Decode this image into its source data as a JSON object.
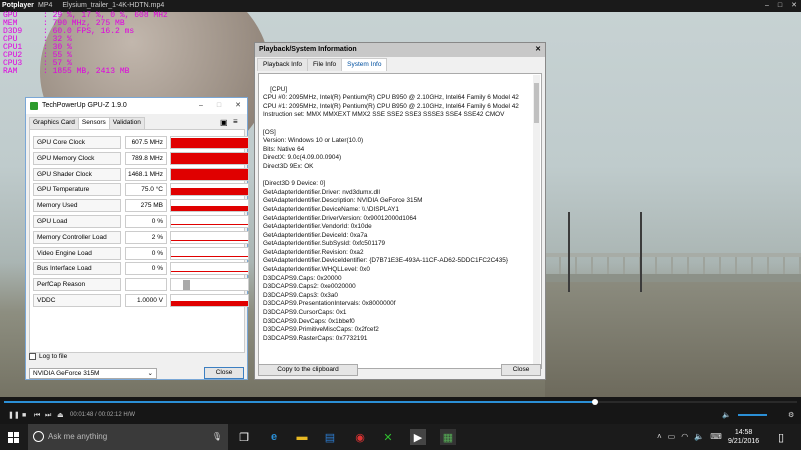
{
  "player": {
    "app_name": "Potplayer",
    "format_tab": "MP4",
    "file_name": "Elysium_trailer_1-4K-HDTN.mp4",
    "window_buttons": [
      "–",
      "□",
      "✕"
    ]
  },
  "osd": [
    {
      "k": "GPU",
      "v": ": 29 %, 17 %, 0 %, 608 MHz"
    },
    {
      "k": "MEM",
      "v": ": 790 MHz, 275 MB"
    },
    {
      "k": "D3D9",
      "v": ": 60.0 FPS, 16.2 ms"
    },
    {
      "k": "CPU",
      "v": ": 32 %"
    },
    {
      "k": "CPU1",
      "v": ": 30 %"
    },
    {
      "k": "CPU2",
      "v": ": 55 %"
    },
    {
      "k": "CPU3",
      "v": ": 57 %"
    },
    {
      "k": "RAM",
      "v": ": 1855 MB, 2413 MB"
    }
  ],
  "controls": {
    "time": "00:01:48 / 00:02:12  H/W",
    "seek_progress": 0.745,
    "volume": 0.8
  },
  "taskbar": {
    "search_placeholder": "Ask me anything",
    "time": "14:58",
    "date": "9/21/2016"
  },
  "gpuz": {
    "title": "TechPowerUp GPU-Z 1.9.0",
    "tabs": [
      "Graphics Card",
      "Sensors",
      "Validation"
    ],
    "active_tab": "Sensors",
    "sensors": [
      {
        "label": "GPU Core Clock",
        "value": "607.5 MHz",
        "level": 0.95
      },
      {
        "label": "GPU Memory Clock",
        "value": "789.8 MHz",
        "level": 0.95
      },
      {
        "label": "GPU Shader Clock",
        "value": "1468.1 MHz",
        "level": 0.95
      },
      {
        "label": "GPU Temperature",
        "value": "75.0 °C",
        "level": 0.7
      },
      {
        "label": "Memory Used",
        "value": "275 MB",
        "level": 0.45
      },
      {
        "label": "GPU Load",
        "value": "0 %",
        "level": 0
      },
      {
        "label": "Memory Controller Load",
        "value": "2 %",
        "level": 0
      },
      {
        "label": "Video Engine Load",
        "value": "0 %",
        "level": 0
      },
      {
        "label": "Bus Interface Load",
        "value": "0 %",
        "level": 0
      },
      {
        "label": "PerfCap Reason",
        "value": "",
        "level": 0
      },
      {
        "label": "VDDC",
        "value": "1.0000 V",
        "level": 0.45
      }
    ],
    "log_to_file": "Log to file",
    "gpu_select": "NVIDIA GeForce 315M",
    "close": "Close"
  },
  "pbinfo": {
    "title": "Playback/System Information",
    "tabs": [
      "Playback Info",
      "File Info",
      "System Info"
    ],
    "active_tab": "System Info",
    "text": "[CPU]\nCPU #0: 2095MHz, Intel(R) Pentium(R) CPU B950 @ 2.10GHz, Intel64 Family 6 Model 42\nCPU #1: 2095MHz, Intel(R) Pentium(R) CPU B950 @ 2.10GHz, Intel64 Family 6 Model 42\nInstruction set: MMX MMXEXT MMX2 SSE SSE2 SSE3 SSSE3 SSE4 SSE42 CMOV\n\n[OS]\nVersion: Windows 10 or Later(10.0)\nBits: Native 64\nDirectX: 9.0c(4.09.00.0904)\nDirect3D 9Ex: OK\n\n[Direct3D 9 Device: 0]\nGetAdapterIdentifier.Driver: nvd3dumx.dll\nGetAdapterIdentifier.Description: NVIDIA GeForce 315M\nGetAdapterIdentifier.DeviceName: \\\\.\\DISPLAY1\nGetAdapterIdentifier.DriverVersion: 0x90012000d1064\nGetAdapterIdentifier.VendorId: 0x10de\nGetAdapterIdentifier.DeviceId: 0xa7a\nGetAdapterIdentifier.SubSysId: 0xfc501179\nGetAdapterIdentifier.Revision: 0xa2\nGetAdapterIdentifier.DeviceIdentifier: {D7B71E3E-493A-11CF-AD62-5DDC1FC2C435}\nGetAdapterIdentifier.WHQLLevel: 0x0\nD3DCAPS9.Caps: 0x20000\nD3DCAPS9.Caps2: 0xe0020000\nD3DCAPS9.Caps3: 0x3a0\nD3DCAPS9.PresentationIntervals: 0x8000000f\nD3DCAPS9.CursorCaps: 0x1\nD3DCAPS9.DevCaps: 0x1bbef0\nD3DCAPS9.PrimitiveMiscCaps: 0x2fcef2\nD3DCAPS9.RasterCaps: 0x7732191",
    "copy_button": "Copy to the clipboard",
    "close": "Close"
  }
}
